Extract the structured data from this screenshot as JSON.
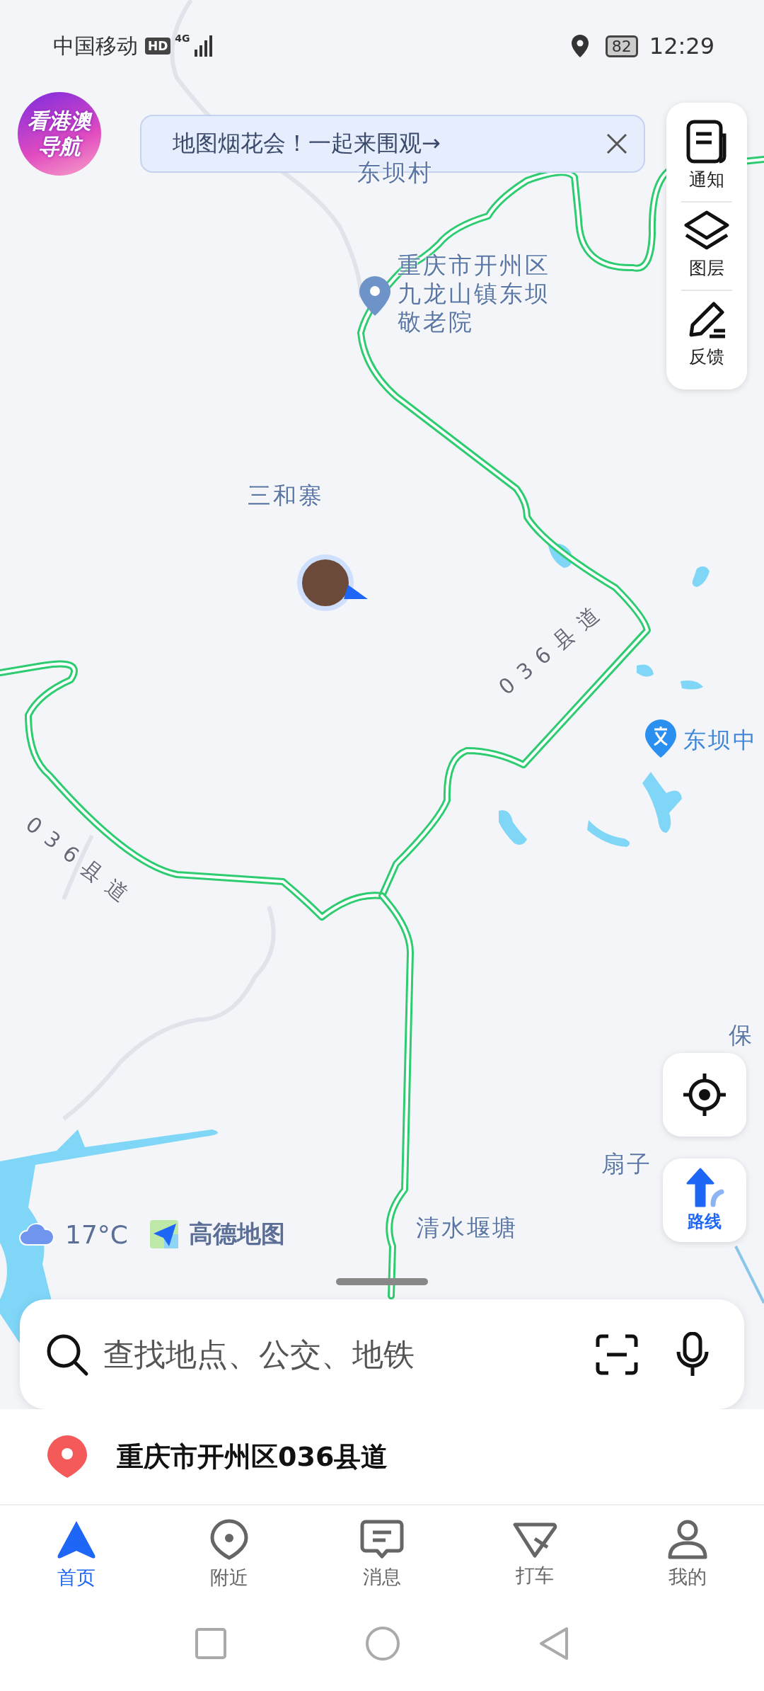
{
  "status_bar": {
    "carrier": "中国移动",
    "network_badge": "HD",
    "network_type": "4G",
    "battery": "82",
    "time": "12:29"
  },
  "promo_badge": {
    "lines": [
      "看港澳",
      "导航"
    ]
  },
  "banner": {
    "text": "地图烟花会！一起来围观→"
  },
  "toolbar": [
    {
      "label": "通知"
    },
    {
      "label": "图层"
    },
    {
      "label": "反馈"
    }
  ],
  "map": {
    "place_labels": [
      "东坝村",
      "三和寨",
      "清水堰塘",
      "扇子",
      "保"
    ],
    "poi": {
      "name": "重庆市开州区九龙山镇东坝敬老院"
    },
    "school": {
      "name": "东坝中"
    },
    "road_labels": [
      "036县道",
      "036县道"
    ]
  },
  "route_button": {
    "label": "路线"
  },
  "weather": {
    "temperature": "17°C"
  },
  "logo": {
    "text": "高德地图"
  },
  "search": {
    "placeholder": "查找地点、公交、地铁"
  },
  "current_location": "重庆市开州区036县道",
  "tabs": [
    {
      "label": "首页",
      "selected": true
    },
    {
      "label": "附近",
      "selected": false
    },
    {
      "label": "消息",
      "selected": false
    },
    {
      "label": "打车",
      "selected": false
    },
    {
      "label": "我的",
      "selected": false
    }
  ]
}
